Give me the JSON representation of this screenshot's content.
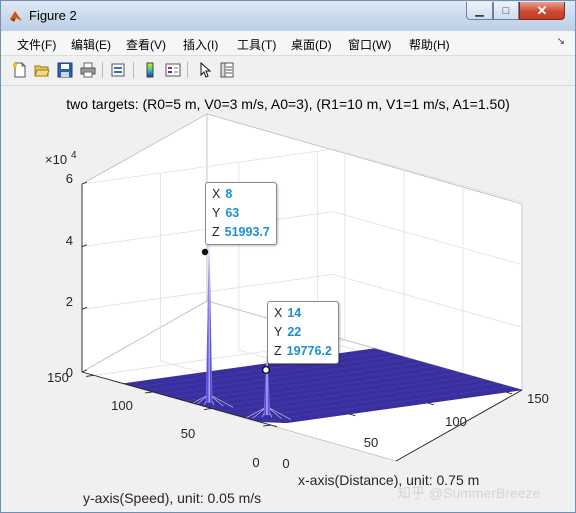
{
  "window": {
    "title": "Figure 2",
    "icon": "matlab-icon",
    "controls": {
      "minimize": "minimize-icon",
      "maximize": "maximize-icon",
      "close": "close-icon"
    }
  },
  "menu": {
    "items": [
      "文件(F)",
      "编辑(E)",
      "查看(V)",
      "插入(I)",
      "工具(T)",
      "桌面(D)",
      "窗口(W)",
      "帮助(H)"
    ],
    "overflow_icon": "chevron-double-icon"
  },
  "toolbar": {
    "buttons": [
      "new-figure-icon",
      "open-folder-icon",
      "save-icon",
      "print-icon",
      "link-icon",
      "colorbar-icon",
      "legend-icon",
      "pointer-icon",
      "property-inspector-icon"
    ]
  },
  "figure": {
    "title": "two targets: (R0=5 m, V0=3 m/s, A0=3), (R1=10 m, V1=1 m/s, A1=1.50)",
    "z_multiplier": "×10",
    "z_exponent": "4",
    "x_axis_label": "x-axis(Distance), unit: 0.75 m",
    "y_axis_label": "y-axis(Speed), unit: 0.05 m/s",
    "z_ticks": [
      "0",
      "2",
      "4",
      "6"
    ],
    "x_ticks": [
      "0",
      "50",
      "100",
      "150"
    ],
    "y_ticks": [
      "0",
      "50",
      "100",
      "150"
    ],
    "surface_color": "#3a2f9f",
    "datatips": [
      {
        "x_label": "X",
        "x_value": "8",
        "y_label": "Y",
        "y_value": "63",
        "z_label": "Z",
        "z_value": "51993.7"
      },
      {
        "x_label": "X",
        "x_value": "14",
        "y_label": "Y",
        "y_value": "22",
        "z_label": "Z",
        "z_value": "19776.2"
      }
    ],
    "watermark": "知乎 @SummerBreeze"
  },
  "chart_data": {
    "type": "surface",
    "title": "two targets: (R0=5 m, V0=3 m/s, A0=3), (R1=10 m, V1=1 m/s, A1=1.50)",
    "xlabel": "x-axis(Distance), unit: 0.75 m",
    "ylabel": "y-axis(Speed), unit: 0.05 m/s",
    "xlim": [
      0,
      160
    ],
    "ylim": [
      0,
      160
    ],
    "zlim": [
      0,
      60000
    ],
    "grid": true,
    "peaks": [
      {
        "x": 8,
        "y": 63,
        "z": 51993.7
      },
      {
        "x": 14,
        "y": 22,
        "z": 19776.2
      }
    ]
  }
}
